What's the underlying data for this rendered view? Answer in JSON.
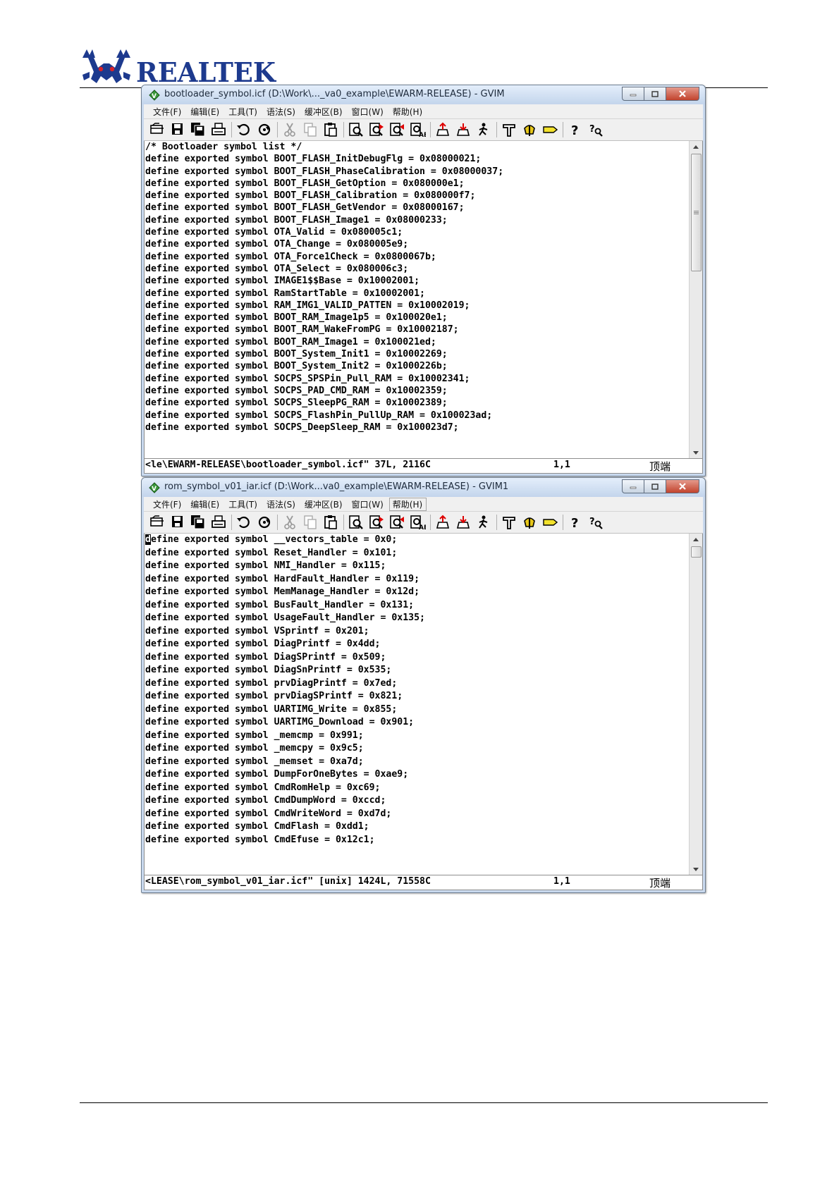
{
  "page": {
    "brand": "REALTEK"
  },
  "windows": [
    {
      "title": "bootloader_symbol.icf (D:\\Work\\..._va0_example\\EWARM-RELEASE) - GVIM",
      "menu": [
        "文件(F)",
        "编辑(E)",
        "工具(T)",
        "语法(S)",
        "缓冲区(B)",
        "窗口(W)",
        "帮助(H)"
      ],
      "menu_hot_index": -1,
      "lines": [
        "/* Bootloader symbol list */",
        "define exported symbol BOOT_FLASH_InitDebugFlg = 0x08000021;",
        "define exported symbol BOOT_FLASH_PhaseCalibration = 0x08000037;",
        "define exported symbol BOOT_FLASH_GetOption = 0x080000e1;",
        "define exported symbol BOOT_FLASH_Calibration = 0x080000f7;",
        "define exported symbol BOOT_FLASH_GetVendor = 0x08000167;",
        "define exported symbol BOOT_FLASH_Image1 = 0x08000233;",
        "define exported symbol OTA_Valid = 0x080005c1;",
        "define exported symbol OTA_Change = 0x080005e9;",
        "define exported symbol OTA_Force1Check = 0x0800067b;",
        "define exported symbol OTA_Select = 0x080006c3;",
        "define exported symbol IMAGE1$$Base = 0x10002001;",
        "define exported symbol RamStartTable = 0x10002001;",
        "define exported symbol RAM_IMG1_VALID_PATTEN = 0x10002019;",
        "define exported symbol BOOT_RAM_Image1p5 = 0x100020e1;",
        "define exported symbol BOOT_RAM_WakeFromPG = 0x10002187;",
        "define exported symbol BOOT_RAM_Image1 = 0x100021ed;",
        "define exported symbol BOOT_System_Init1 = 0x10002269;",
        "define exported symbol BOOT_System_Init2 = 0x1000226b;",
        "define exported symbol SOCPS_SPSPin_Pull_RAM = 0x10002341;",
        "define exported symbol SOCPS_PAD_CMD_RAM = 0x10002359;",
        "define exported symbol SOCPS_SleepPG_RAM = 0x10002389;",
        "define exported symbol SOCPS_FlashPin_PullUp_RAM = 0x100023ad;",
        "define exported symbol SOCPS_DeepSleep_RAM = 0x100023d7;"
      ],
      "status": {
        "file": "<le\\EWARM-RELEASE\\bootloader_symbol.icf\" 37L, 2116C",
        "position": "1,1",
        "scroll": "顶端"
      }
    },
    {
      "title": "rom_symbol_v01_iar.icf (D:\\Work...va0_example\\EWARM-RELEASE) - GVIM1",
      "menu": [
        "文件(F)",
        "编辑(E)",
        "工具(T)",
        "语法(S)",
        "缓冲区(B)",
        "窗口(W)",
        "帮助(H)"
      ],
      "menu_hot_index": 6,
      "lines": [
        "define exported symbol __vectors_table = 0x0;",
        "define exported symbol Reset_Handler = 0x101;",
        "define exported symbol NMI_Handler = 0x115;",
        "define exported symbol HardFault_Handler = 0x119;",
        "define exported symbol MemManage_Handler = 0x12d;",
        "define exported symbol BusFault_Handler = 0x131;",
        "define exported symbol UsageFault_Handler = 0x135;",
        "define exported symbol VSprintf = 0x201;",
        "define exported symbol DiagPrintf = 0x4dd;",
        "define exported symbol DiagSPrintf = 0x509;",
        "define exported symbol DiagSnPrintf = 0x535;",
        "define exported symbol prvDiagPrintf = 0x7ed;",
        "define exported symbol prvDiagSPrintf = 0x821;",
        "define exported symbol UARTIMG_Write = 0x855;",
        "define exported symbol UARTIMG_Download = 0x901;",
        "define exported symbol _memcmp = 0x991;",
        "define exported symbol _memcpy = 0x9c5;",
        "define exported symbol _memset = 0xa7d;",
        "define exported symbol DumpForOneBytes = 0xae9;",
        "define exported symbol CmdRomHelp = 0xc69;",
        "define exported symbol CmdDumpWord = 0xccd;",
        "define exported symbol CmdWriteWord = 0xd7d;",
        "define exported symbol CmdFlash = 0xdd1;",
        "define exported symbol CmdEfuse = 0x12c1;"
      ],
      "status": {
        "file": "<LEASE\\rom_symbol_v01_iar.icf\" [unix] 1424L, 71558C",
        "position": "1,1",
        "scroll": "顶端"
      }
    }
  ],
  "toolbar_icons": [
    "open-icon",
    "save-icon",
    "save-all-icon",
    "print-icon",
    "sep",
    "undo-icon",
    "redo-icon",
    "sep",
    "cut-icon",
    "copy-icon",
    "paste-icon",
    "sep",
    "find-icon",
    "find-next-icon",
    "find-prev-icon",
    "replace-icon",
    "sep",
    "load-session-icon",
    "save-session-icon",
    "run-script-icon",
    "sep",
    "make-icon",
    "shell-icon",
    "tags-icon",
    "sep",
    "help-icon",
    "help-search-icon"
  ],
  "colors": {
    "title_gradient_top": "#e4eefb",
    "title_gradient_bottom": "#c3d5ec",
    "close_button": "#c2432d",
    "logo_blue": "#1d3a8e",
    "logo_red": "#d8232a"
  }
}
